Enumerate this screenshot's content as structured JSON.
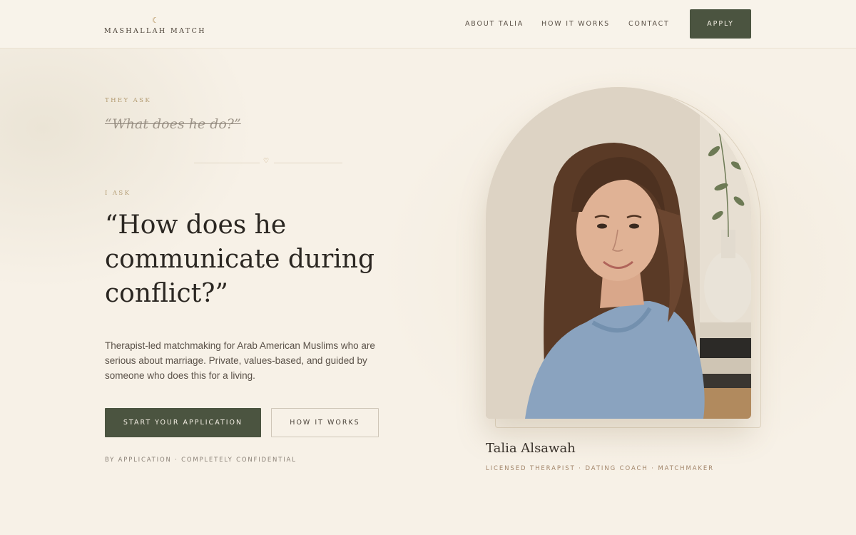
{
  "header": {
    "logo_mark": "☾",
    "logo_text": "MASHALLAH MATCH",
    "nav": {
      "about": "ABOUT TALIA",
      "how": "HOW IT WORKS",
      "contact": "CONTACT"
    },
    "apply_label": "APPLY"
  },
  "hero": {
    "they_ask_label": "THEY ASK",
    "old_question": "“What does he do?”",
    "divider_icon": "heart-icon",
    "i_ask_label": "I ASK",
    "headline_lines": [
      "“How does he",
      "communicate during",
      "conflict?”"
    ],
    "body": "Therapist-led matchmaking for Arab American Muslims who are serious about marriage. Private, values-based, and guided by someone who does this for a living.",
    "primary_cta": "START YOUR APPLICATION",
    "secondary_cta": "HOW IT WORKS",
    "footnote": "BY APPLICATION · COMPLETELY CONFIDENTIAL"
  },
  "portrait": {
    "name": "Talia Alsawah",
    "role": "LICENSED THERAPIST · DATING COACH · MATCHMAKER"
  },
  "colors": {
    "background": "#f7f1e7",
    "accent_green": "#4b5440",
    "gold": "#b29a70",
    "text_dark": "#2b2722"
  }
}
